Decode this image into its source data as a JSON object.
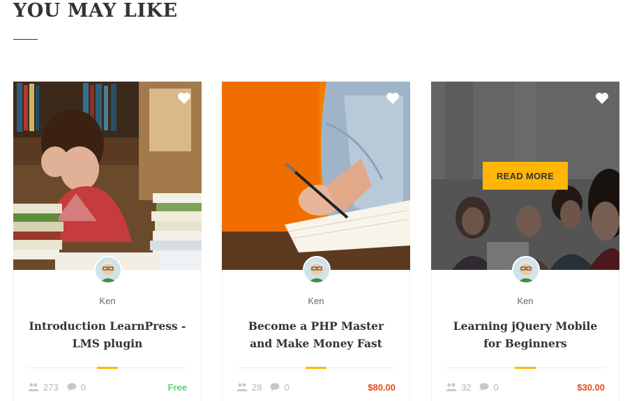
{
  "section": {
    "title": "YOU MAY LIKE"
  },
  "courses": [
    {
      "author": "Ken",
      "title": "Introduction LearnPress - LMS plugin",
      "students": "273",
      "comments": "0",
      "price": "Free"
    },
    {
      "author": "Ken",
      "title": "Become a PHP Master and Make Money Fast",
      "students": "28",
      "comments": "0",
      "price": "$80.00"
    },
    {
      "author": "Ken",
      "title": "Learning jQuery Mobile for Beginners",
      "students": "32",
      "comments": "0",
      "price": "$30.00",
      "hover_button": "READ MORE"
    }
  ],
  "icons": [
    "heart-icon",
    "users-icon",
    "comment-icon",
    "avatar-image"
  ],
  "colors": {
    "accent": "#ffb606",
    "free": "#61ce70",
    "price": "#e64c1c",
    "title": "#333333"
  }
}
